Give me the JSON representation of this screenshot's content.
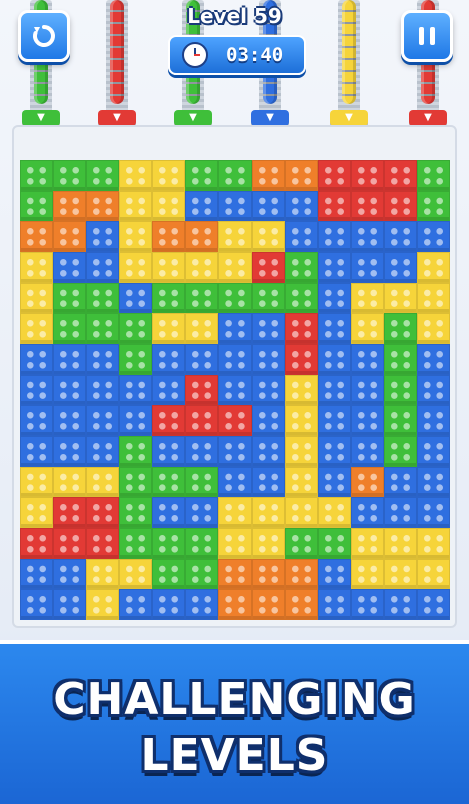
{
  "hud": {
    "level_label": "Level 59",
    "timer": "03:40",
    "restart_icon": "restart-icon",
    "pause_icon": "pause-icon",
    "clock_icon": "clock-icon"
  },
  "colors": {
    "green": "#3fbf3a",
    "red": "#e23a35",
    "blue": "#2f6fe0",
    "yellow": "#f6d43a",
    "orange": "#ef7f2a",
    "hud_blue": "#1f78e6"
  },
  "rails": [
    {
      "color": "green",
      "arrow": "▼"
    },
    {
      "color": "red",
      "arrow": "▼"
    },
    {
      "color": "green",
      "arrow": "▼"
    },
    {
      "color": "blue",
      "arrow": "▼"
    },
    {
      "color": "yellow",
      "arrow": "▼"
    },
    {
      "color": "red",
      "arrow": "▼"
    }
  ],
  "board": {
    "rows": [
      "GGGYYGGOORRRG",
      "GOOYYBBBBRRRG",
      "OOBYOOYYBBBBB",
      "YBBYYYYRGBBBY",
      "YGGBGGGGGBYYY",
      "YGGGYYBBRBYGY",
      "BBBGBBBBRBBGB",
      "BBBBBRBBYBBGB",
      "BBBBRRRBYBBGB",
      "BBBGBBBBYBBGB",
      "YYYGGGBBYBOBB",
      "YRRGBBYYYYBBB",
      "RRRGGGYYGGYYY",
      "BBYYGGOOOBYYY",
      "BBYBBBOOOBBBB"
    ]
  },
  "banner": {
    "line1": "CHALLENGING",
    "line2": "LEVELS"
  }
}
